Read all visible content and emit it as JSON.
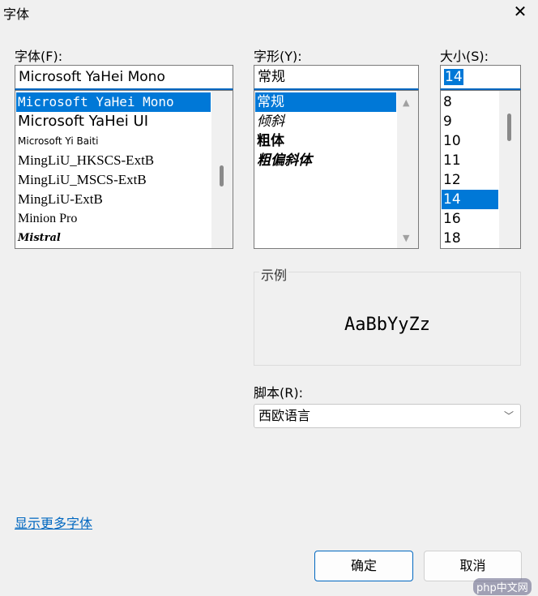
{
  "window": {
    "title": "字体"
  },
  "font": {
    "label": "字体(F):",
    "value": "Microsoft YaHei Mono",
    "items": [
      "Microsoft YaHei Mono",
      "Microsoft YaHei UI",
      "Microsoft Yi Baiti",
      "MingLiU_HKSCS-ExtB",
      "MingLiU_MSCS-ExtB",
      "MingLiU-ExtB",
      "Minion Pro",
      "Mistral"
    ],
    "selected": 0
  },
  "style": {
    "label": "字形(Y):",
    "value": "常规",
    "items": [
      "常规",
      "倾斜",
      "粗体",
      "粗偏斜体"
    ],
    "selected": 0
  },
  "size": {
    "label": "大小(S):",
    "value": "14",
    "items": [
      "8",
      "9",
      "10",
      "11",
      "12",
      "14",
      "16",
      "18"
    ],
    "selected": 5
  },
  "sample": {
    "label": "示例",
    "text": "AaBbYyZz"
  },
  "script": {
    "label": "脚本(R):",
    "value": "西欧语言"
  },
  "more_fonts_link": "显示更多字体",
  "buttons": {
    "ok": "确定",
    "cancel": "取消"
  },
  "watermark": "php中文网",
  "colors": {
    "accent": "#0078d7",
    "link": "#0067c0"
  }
}
